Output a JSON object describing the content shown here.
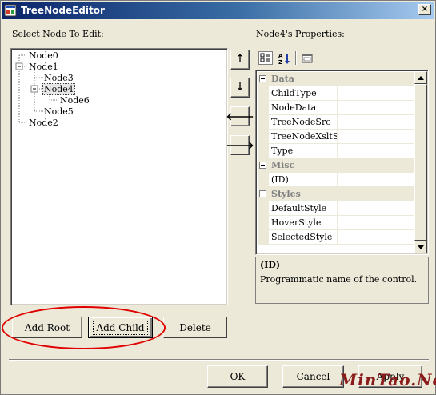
{
  "window": {
    "title": "TreeNodeEditor",
    "close_glyph": "×"
  },
  "left_panel": {
    "label": "Select Node To Edit:",
    "nodes": [
      {
        "label": "Node0",
        "depth": 0,
        "selected": false
      },
      {
        "label": "Node1",
        "depth": 0,
        "selected": false,
        "expanded": true
      },
      {
        "label": "Node3",
        "depth": 1,
        "selected": false
      },
      {
        "label": "Node4",
        "depth": 1,
        "selected": true,
        "expanded": true
      },
      {
        "label": "Node6",
        "depth": 2,
        "selected": false
      },
      {
        "label": "Node5",
        "depth": 1,
        "selected": false
      },
      {
        "label": "Node2",
        "depth": 0,
        "selected": false
      }
    ],
    "buttons": {
      "add_root": "Add Root",
      "add_child": "Add Child",
      "delete": "Delete"
    }
  },
  "move_buttons": [
    {
      "name": "move-up-button",
      "glyph": "🡑",
      "icon": "arrow-up-icon"
    },
    {
      "name": "move-down-button",
      "glyph": "🡓",
      "icon": "arrow-down-icon"
    },
    {
      "name": "move-left-button",
      "glyph": "🡐",
      "icon": "arrow-left-icon"
    },
    {
      "name": "move-right-button",
      "glyph": "🡒",
      "icon": "arrow-right-icon"
    }
  ],
  "right_panel": {
    "label": "Node4's Properties:",
    "toolbar": {
      "categorized_icon": "categorized-icon",
      "alphabetical_icon": "alphabetical-icon",
      "property_pages_icon": "property-pages-icon"
    },
    "categories": [
      {
        "label": "Data",
        "properties": [
          "ChildType",
          "NodeData",
          "TreeNodeSrc",
          "TreeNodeXsltSrc",
          "Type"
        ]
      },
      {
        "label": "Misc",
        "properties": [
          "(ID)"
        ]
      },
      {
        "label": "Styles",
        "properties": [
          "DefaultStyle",
          "HoverStyle",
          "SelectedStyle"
        ]
      }
    ],
    "description": {
      "title": "(ID)",
      "text": "Programmatic name of the control."
    }
  },
  "footer": {
    "ok": "OK",
    "cancel": "Cancel",
    "apply": "Apply"
  },
  "watermark": "MinTao.Net",
  "colors": {
    "annotation_ellipse": "#e00000",
    "titlebar_start": "#0a246a",
    "titlebar_end": "#a6caf0"
  }
}
